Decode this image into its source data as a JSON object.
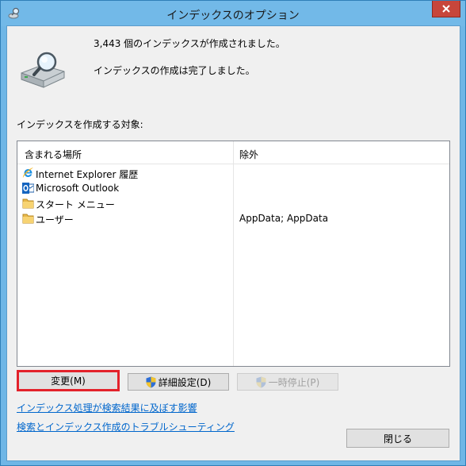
{
  "window": {
    "title": "インデックスのオプション"
  },
  "status": {
    "count_text": "3,443 個のインデックスが作成されました。",
    "complete_text": "インデックスの作成は完了しました。"
  },
  "target_label": "インデックスを作成する対象:",
  "table": {
    "headers": [
      "含まれる場所",
      "除外"
    ],
    "rows": [
      {
        "icon": "internet-explorer-icon",
        "name": "Internet Explorer 履歴",
        "exclude": ""
      },
      {
        "icon": "outlook-icon",
        "name": "Microsoft Outlook",
        "exclude": ""
      },
      {
        "icon": "folder-icon",
        "name": "スタート メニュー",
        "exclude": ""
      },
      {
        "icon": "folder-icon",
        "name": "ユーザー",
        "exclude": "AppData; AppData"
      }
    ]
  },
  "buttons": {
    "change": "変更(M)",
    "advanced": "詳細設定(D)",
    "pause": "一時停止(P)",
    "close": "閉じる"
  },
  "links": {
    "effect": "インデックス処理が検索結果に及ぼす影響",
    "troubleshoot": "検索とインデックス作成のトラブルシューティング"
  },
  "colors": {
    "titlebar": "#72b9e8",
    "close_button": "#c7463b",
    "highlight_border": "#e3222b",
    "link": "#0066cc"
  }
}
